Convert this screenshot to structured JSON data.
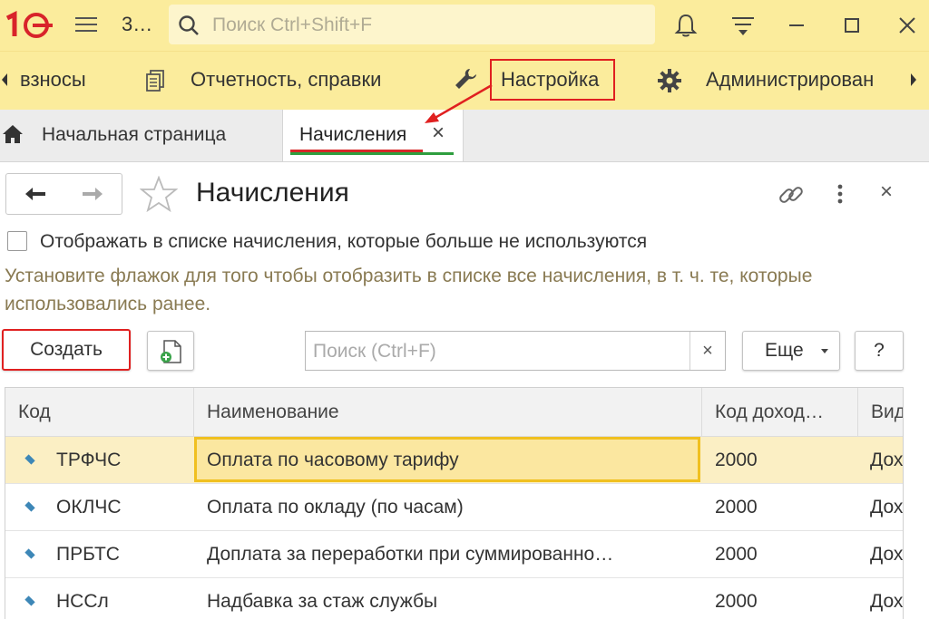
{
  "topbar": {
    "logo_text": "1С",
    "app_title": "3…",
    "search_placeholder": "Поиск Ctrl+Shift+F"
  },
  "sections": {
    "items": [
      {
        "label": "взносы",
        "icon": "scroll-left-arrow-icon"
      },
      {
        "label": "Отчетность, справки",
        "icon": "reports-icon"
      },
      {
        "label": "Настройка",
        "icon": "wrench-icon"
      },
      {
        "label": "Администрирован",
        "icon": "gear-icon"
      }
    ]
  },
  "tabs": [
    {
      "label": "Начальная страница",
      "icon": "home-icon"
    },
    {
      "label": "Начисления",
      "active": true,
      "close": "×"
    }
  ],
  "form": {
    "title": "Начисления",
    "close": "×",
    "checkbox_label": "Отображать в списке начисления, которые больше не используются",
    "checkbox_checked": false,
    "hint": "Установите флажок для того чтобы отобразить в списке все начисления, в т. ч. те, которые использовались ранее."
  },
  "toolbar": {
    "create_label": "Создать",
    "search_placeholder": "Поиск (Ctrl+F)",
    "search_clear": "×",
    "more_label": "Еще",
    "help_label": "?"
  },
  "table": {
    "columns": [
      "Код",
      "Наименование",
      "Код доход…",
      "Вид"
    ],
    "rows": [
      {
        "code": "ТРФЧС",
        "name": "Оплата по часовому тарифу",
        "income_code": "2000",
        "kind": "Дох"
      },
      {
        "code": "ОКЛЧС",
        "name": "Оплата по окладу (по часам)",
        "income_code": "2000",
        "kind": "Дох"
      },
      {
        "code": "ПРБТС",
        "name": "Доплата за переработки при суммированно…",
        "income_code": "2000",
        "kind": "Дох"
      },
      {
        "code": "НССл",
        "name": "Надбавка за стаж службы",
        "income_code": "2000",
        "kind": "Дох"
      }
    ]
  },
  "colors": {
    "toolbar_bg": "#fbec9c",
    "annotation_red": "#e02020",
    "tab_underline_red": "#d62828",
    "tab_underline_green": "#2e9e3e",
    "selected_row_bg": "#fbefc4",
    "focus_cell_border": "#f0c020",
    "hint_text": "#897a52"
  }
}
